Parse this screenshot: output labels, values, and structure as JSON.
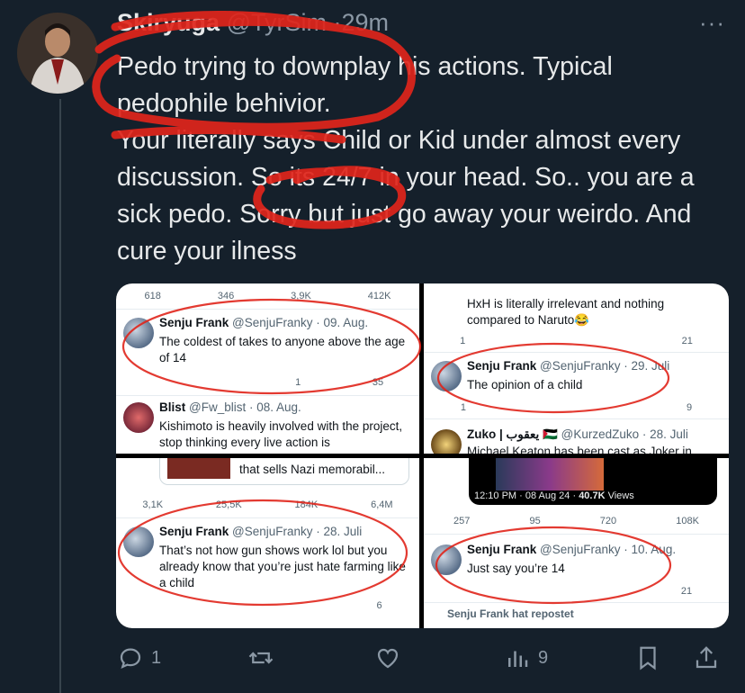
{
  "author": {
    "name": "Skiryuga",
    "handle": "@TyrSim",
    "separator": "·",
    "time": "29m"
  },
  "more_label": "···",
  "tweet": {
    "lines": [
      "Pedo trying to downplay his actions. Typical pedophile behivior.",
      "Your literally says Child or Kid under almost every discussion. So its 24/7 in your head. So.. you are a sick pedo. Sorry but just go away your weirdo. And cure your ilness"
    ]
  },
  "shots": {
    "top_left": {
      "top_actions": [
        "618",
        "346",
        "3,9K",
        "412K",
        "",
        ""
      ],
      "tweet1": {
        "name": "Senju Frank",
        "handle": "@SenjuFranky · 09. Aug.",
        "text": "The coldest of takes to anyone above the age of 14",
        "actions": [
          "",
          "",
          "1",
          "35",
          "",
          ""
        ]
      },
      "tweet2": {
        "name": "Blist",
        "handle": "@Fw_blist · 08. Aug.",
        "text": "Kishimoto is heavily involved with the project, stop thinking every live action is"
      }
    },
    "top_right": {
      "top_text": "HxH is literally irrelevant and nothing compared to Naruto😂",
      "top_actions": [
        "1",
        "",
        "",
        "21",
        "",
        ""
      ],
      "tweet1": {
        "name": "Senju Frank",
        "handle": "@SenjuFranky · 29. Juli",
        "text": "The opinion of a child",
        "actions": [
          "1",
          "",
          "",
          "9",
          "",
          ""
        ]
      },
      "tweet2": {
        "name": "Zuko | يعقوب 🇵🇸",
        "handle": "@KurzedZuko · 28. Juli",
        "text": "Michael Keaton has been cast as Joker in"
      }
    },
    "bottom_left": {
      "embed_text": "that sells Nazi memorabil...",
      "top_actions": [
        "3,1K",
        "25,5K",
        "184K",
        "6,4M",
        "",
        ""
      ],
      "tweet1": {
        "name": "Senju Frank",
        "handle": "@SenjuFranky · 28. Juli",
        "text": "That’s not how gun shows work lol but you already know that you’re just hate farming like a child",
        "actions": [
          "",
          "",
          "",
          "6",
          "",
          ""
        ]
      }
    },
    "bottom_right": {
      "timestamp": "12:10 PM · 08 Aug 24 · ",
      "views": "40.7K",
      "views_label": " Views",
      "top_actions": [
        "257",
        "95",
        "720",
        "108K",
        "",
        ""
      ],
      "tweet1": {
        "name": "Senju Frank",
        "handle": "@SenjuFranky · 10. Aug.",
        "text": "Just say you’re 14",
        "actions": [
          "",
          "",
          "",
          "21",
          "",
          ""
        ]
      },
      "repost_label": "Senju Frank hat repostet"
    }
  },
  "actions": {
    "replies": "1",
    "views": "9"
  },
  "colors": {
    "background": "#15202b",
    "text": "#e7e9ea",
    "muted": "#8b98a5",
    "scribble": "#e0251b"
  }
}
